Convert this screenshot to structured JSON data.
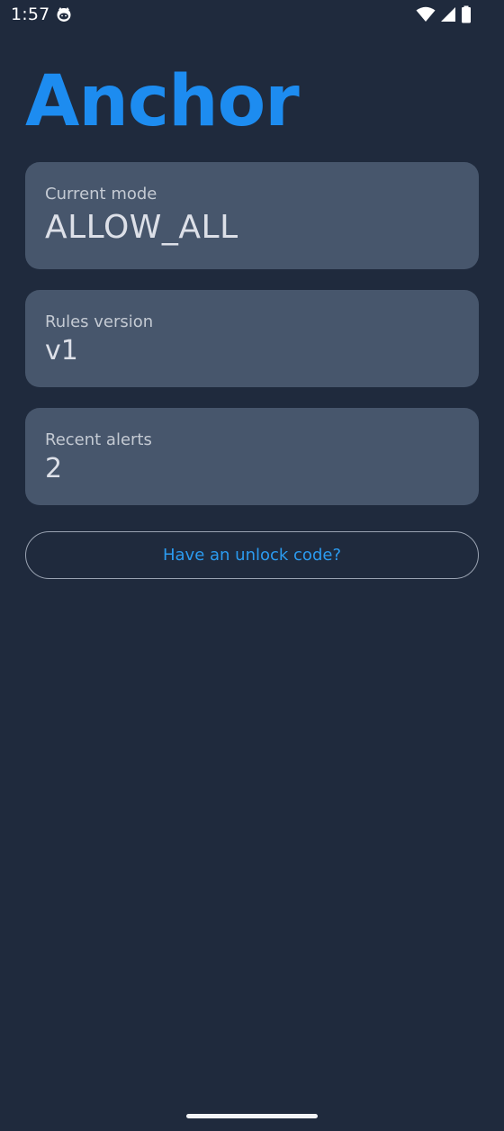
{
  "status_bar": {
    "time": "1:57",
    "app_notification_icon": "cat-face-icon",
    "icons": [
      "wifi-icon",
      "cellular-signal-icon",
      "battery-icon"
    ]
  },
  "app": {
    "title": "Anchor",
    "accent_color": "#1d8cf0",
    "background_color": "#1f2a3d",
    "card_color": "#47566c"
  },
  "cards": {
    "mode": {
      "label": "Current mode",
      "value": "ALLOW_ALL"
    },
    "rules": {
      "label": "Rules version",
      "value": "v1"
    },
    "alerts": {
      "label": "Recent alerts",
      "value": "2"
    }
  },
  "unlock": {
    "label": "Have an unlock code?"
  }
}
